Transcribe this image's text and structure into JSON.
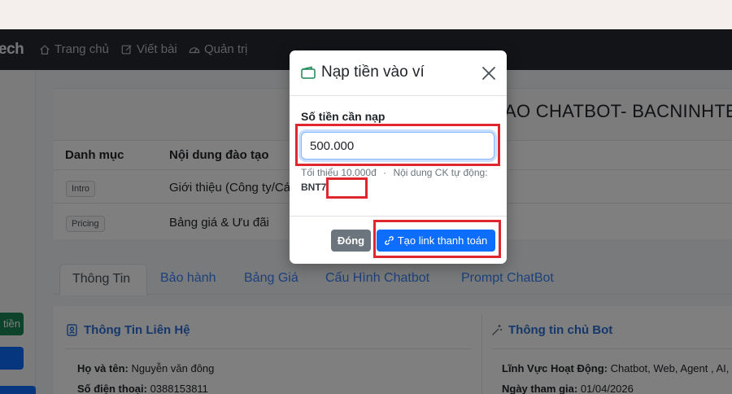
{
  "navbar": {
    "brand": "ech",
    "items": [
      {
        "label": "Trang chủ",
        "icon": "home-icon"
      },
      {
        "label": "Viết bài",
        "icon": "edit-icon"
      },
      {
        "label": "Quản trị",
        "icon": "dashboard-icon"
      }
    ]
  },
  "page": {
    "heading": "AO CHATBOT- BACNINHTE",
    "table": {
      "headers": [
        "Danh mục",
        "Nội dung đào tạo"
      ],
      "rows": [
        {
          "badge": "Intro",
          "content": "Giới thiệu (Công ty/Cá"
        },
        {
          "badge": "Pricing",
          "content": "Bảng giá & Ưu đãi"
        }
      ]
    },
    "tabs": [
      "Thông Tin",
      "Bảo hành",
      "Bảng Giá",
      "Cấu Hình Chatbot",
      "Prompt ChatBot"
    ],
    "contact": {
      "title": "Thông Tin Liên Hệ",
      "name_label": "Họ và tên:",
      "name_value": "Nguyễn văn đông",
      "phone_label": "Số điện thoại:",
      "phone_value": "0388153811"
    },
    "owner": {
      "title": "Thông tin chủ Bot",
      "field_label": "Lĩnh Vực Hoạt Động:",
      "field_value": "Chatbot, Web, Agent , AI,",
      "joined_label": "Ngày tham gia:",
      "joined_value": "01/04/2026"
    },
    "sidebar_button_label": "tiền"
  },
  "modal": {
    "title": "Nạp tiền vào ví",
    "amount_label": "Số tiền cần nạp",
    "amount_value": "500.000",
    "hint_min": "Tối thiểu 10.000đ",
    "hint_sep": "·",
    "hint_auto": "Nội dung CK tự động:",
    "transfer_code": "BNT7",
    "close_label": "Đóng",
    "create_label": "Tạo link thanh toán"
  },
  "colors": {
    "primary": "#0d6efd",
    "secondary": "#6c757d",
    "highlight": "#e0262f",
    "navbar": "#25292e"
  }
}
